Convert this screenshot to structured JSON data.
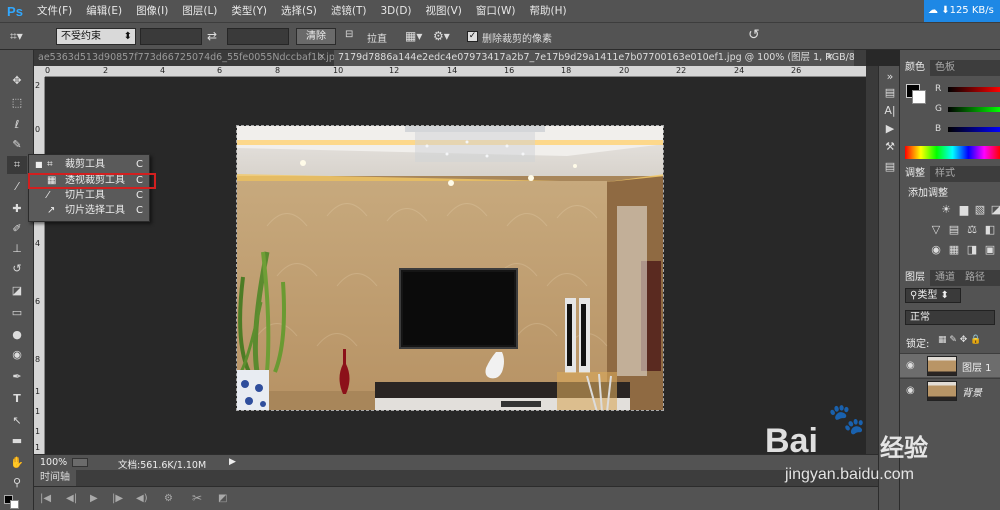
{
  "app": {
    "logo": "Ps"
  },
  "menu": [
    "文件(F)",
    "编辑(E)",
    "图像(I)",
    "图层(L)",
    "类型(Y)",
    "选择(S)",
    "滤镜(T)",
    "3D(D)",
    "视图(V)",
    "窗口(W)",
    "帮助(H)"
  ],
  "options": {
    "ratio_select": "不受约束",
    "clear_button": "清除",
    "straighten_label": "拉直",
    "delete_cropped_label": "删除裁剪的像素"
  },
  "network": {
    "speed": "125 KB/s"
  },
  "tabs": {
    "tab1": "ae5363d513d90857f773d66725074d6_55fe0055Ndccbaf1b.jpg",
    "tab2": "7179d7886a144e2edc4e07973417a2b7_7e17b9d29a1411e7b07700163e010ef1.jpg @ 100% (图层 1, RGB/8#) *"
  },
  "ruler": {
    "top": [
      "0",
      "2",
      "4",
      "6",
      "8",
      "10",
      "12",
      "14",
      "16",
      "18",
      "20",
      "22",
      "24",
      "26"
    ],
    "left": [
      "2",
      "0",
      "2",
      "4",
      "6",
      "8",
      "1",
      "1",
      "1",
      "1"
    ]
  },
  "flyout": [
    {
      "label": "裁剪工具",
      "key": "C",
      "selected": true
    },
    {
      "label": "透视裁剪工具",
      "key": "C",
      "selected": false
    },
    {
      "label": "切片工具",
      "key": "C",
      "selected": false
    },
    {
      "label": "切片选择工具",
      "key": "C",
      "selected": false
    }
  ],
  "status": {
    "zoom": "100%",
    "doc": "文档:561.6K/1.10M"
  },
  "timeline": {
    "tab": "时间轴"
  },
  "panels": {
    "color_tabs": [
      "颜色",
      "色板"
    ],
    "channels": [
      "R",
      "G",
      "B"
    ],
    "adjust_tabs": [
      "调整",
      "样式"
    ],
    "adjust_title": "添加调整",
    "layer_tabs": [
      "图层",
      "通道",
      "路径"
    ],
    "kind": "类型",
    "blend": "正常",
    "lock": "锁定:",
    "layers": [
      {
        "name": "图层 1"
      },
      {
        "name": "背景"
      }
    ]
  },
  "watermark": {
    "brand": "Bai",
    "brand2": "经验",
    "url": "jingyan.baidu.com"
  },
  "colors": {
    "highlight": "#d21f1f",
    "ps_blue": "#31a8ff"
  }
}
